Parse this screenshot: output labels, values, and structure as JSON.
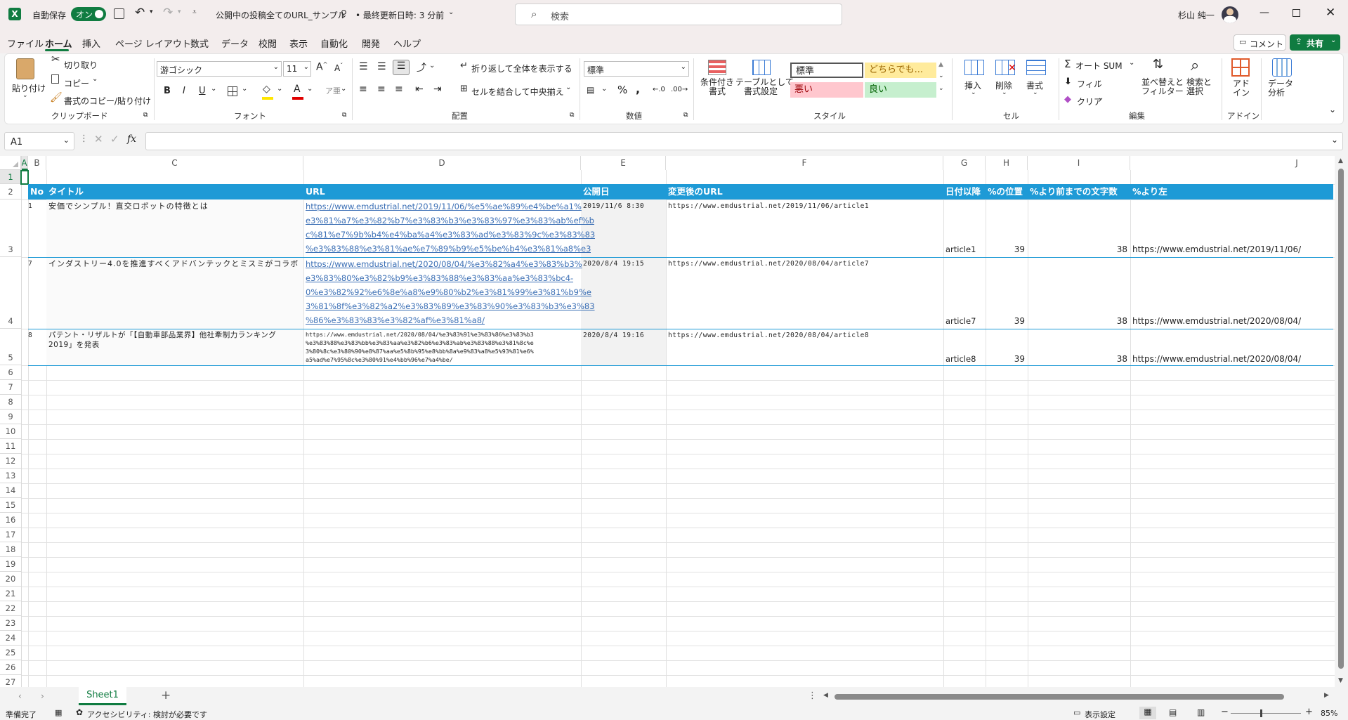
{
  "titlebar": {
    "autosave_label": "自動保存",
    "autosave_toggle": "オン",
    "doc_title": "公開中の投稿全てのURL_サンプル",
    "last_saved": "• 最終更新日時: 3 分前",
    "search_placeholder": "検索",
    "user_name": "杉山 純一"
  },
  "menu": {
    "items": [
      "ファイル",
      "ホーム",
      "挿入",
      "ページ レイアウト",
      "数式",
      "データ",
      "校閲",
      "表示",
      "自動化",
      "開発",
      "ヘルプ"
    ],
    "active": "ホーム",
    "comment_button": "コメント",
    "share_button": "共有"
  },
  "ribbon": {
    "clipboard": {
      "paste": "貼り付け",
      "cut": "切り取り",
      "copy": "コピー",
      "format_painter": "書式のコピー/貼り付け",
      "group": "クリップボード"
    },
    "font": {
      "name": "游ゴシック",
      "size": "11",
      "bold": "B",
      "italic": "I",
      "underline": "U",
      "group": "フォント"
    },
    "alignment": {
      "wrap": "折り返して全体を表示する",
      "merge": "セルを結合して中央揃え",
      "group": "配置"
    },
    "number": {
      "format": "標準",
      "group": "数値"
    },
    "styles": {
      "conditional": "条件付き\n書式",
      "table": "テーブルとして\n書式設定",
      "style_normal": "標準",
      "style_neutral": "どちらでも...",
      "style_bad": "悪い",
      "style_good": "良い",
      "group": "スタイル"
    },
    "cells": {
      "insert": "挿入",
      "delete": "削除",
      "format": "書式",
      "group": "セル"
    },
    "editing": {
      "autosum": "オート SUM",
      "fill": "フィル",
      "clear": "クリア",
      "sort": "並べ替えと\nフィルター",
      "find": "検索と\n選択",
      "group": "編集"
    },
    "addins": {
      "addin": "アド\nイン",
      "group": "アドイン"
    },
    "analysis": {
      "data_analysis": "データ\n分析"
    }
  },
  "formula_bar": {
    "name_box": "A1",
    "fx": "fx",
    "value": ""
  },
  "columns": [
    "A",
    "B",
    "C",
    "D",
    "E",
    "F",
    "G",
    "H",
    "I",
    "J"
  ],
  "rows": [
    "1",
    "2",
    "3",
    "4",
    "5",
    "6",
    "7",
    "8",
    "9",
    "10",
    "11",
    "12",
    "13",
    "14",
    "15",
    "16",
    "17",
    "18",
    "19",
    "20",
    "21",
    "22",
    "23",
    "24",
    "25",
    "26",
    "27"
  ],
  "table_headers": {
    "B": "No",
    "C": "タイトル",
    "D": "URL",
    "E": "公開日",
    "F": "変更後のURL",
    "G": "日付以降",
    "H": "%の位置",
    "I": "%より前までの文字数",
    "J": "%より左"
  },
  "table_rows": [
    {
      "no": "1",
      "title": "安価でシンプル！直交ロボットの特徴とは",
      "url_lines": [
        "https://www.emdustrial.net/2019/11/06/%e5%ae%89%e4%be%a1%",
        "e3%81%a7%e3%82%b7%e3%83%b3%e3%83%97%e3%83%ab%ef%b",
        "c%81%e7%9b%b4%e4%ba%a4%e3%83%ad%e3%83%9c%e3%83%83",
        "%e3%83%88%e3%81%ae%e7%89%b9%e5%be%b4%e3%81%a8%e3"
      ],
      "date": "2019/11/6 8:30",
      "new_url": "https://www.emdustrial.net/2019/11/06/article1",
      "after_date": "article1",
      "pct_pos": "39",
      "chars_before": "38",
      "left_of_pct": "https://www.emdustrial.net/2019/11/06/"
    },
    {
      "no": "7",
      "title": "インダストリー4.0を推進すべくアドバンテックとミスミがコラボ",
      "url_lines": [
        "https://www.emdustrial.net/2020/08/04/%e3%82%a4%e3%83%b3%",
        "e3%83%80%e3%82%b9%e3%83%88%e3%83%aa%e3%83%bc4-",
        "0%e3%82%92%e6%8e%a8%e9%80%b2%e3%81%99%e3%81%b9%e",
        "3%81%8f%e3%82%a2%e3%83%89%e3%83%90%e3%83%b3%e3%83",
        "%86%e3%83%83%e3%82%af%e3%81%a8/"
      ],
      "date": "2020/8/4 19:15",
      "new_url": "https://www.emdustrial.net/2020/08/04/article7",
      "after_date": "article7",
      "pct_pos": "39",
      "chars_before": "38",
      "left_of_pct": "https://www.emdustrial.net/2020/08/04/"
    },
    {
      "no": "8",
      "title_lines": [
        "パテント・リザルトが「【自動車部品業界】他社牽制力ランキング",
        "2019」を発表"
      ],
      "url_lines": [
        "https://www.emdustrial.net/2020/08/04/%e3%83%91%e3%83%86%e3%83%b3",
        "%e3%83%88%e3%83%bb%e3%83%aa%e3%82%b6%e3%83%ab%e3%83%88%e3%81%8c%e",
        "3%80%8c%e3%80%90%e8%87%aa%e5%8b%95%e8%bb%8a%e9%83%a8%e5%93%81%e6%",
        "a5%ad%e7%95%8c%e3%80%91%e4%bb%96%e7%a4%be/"
      ],
      "date": "2020/8/4 19:16",
      "new_url": "https://www.emdustrial.net/2020/08/04/article8",
      "after_date": "article8",
      "pct_pos": "39",
      "chars_before": "38",
      "left_of_pct": "https://www.emdustrial.net/2020/08/04/"
    }
  ],
  "sheet_tabs": [
    "Sheet1"
  ],
  "status": {
    "ready": "準備完了",
    "accessibility": "アクセシビリティ: 検討が必要です",
    "display_settings": "表示設定",
    "zoom": "85%"
  },
  "colors": {
    "accent_green": "#107c41",
    "header_blue": "#1e9ad6",
    "link": "#3b6fb5"
  }
}
